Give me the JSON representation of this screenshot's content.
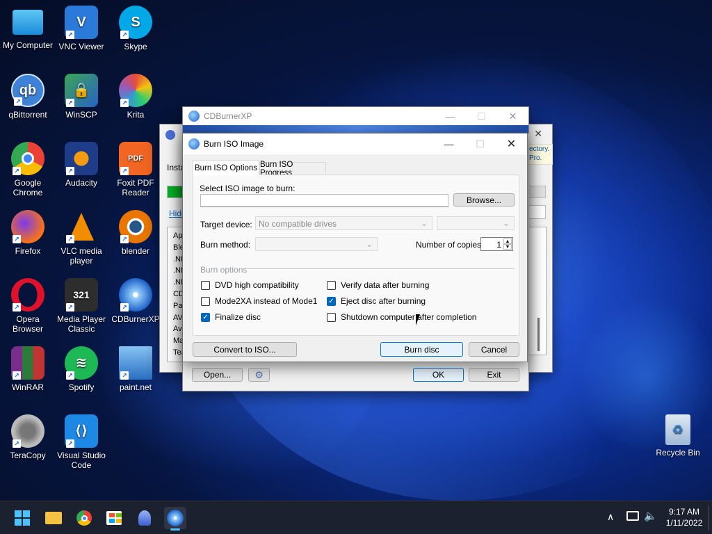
{
  "desktop": {
    "icons": [
      {
        "label": "My Computer",
        "icon": "computer-icon"
      },
      {
        "label": "VNC Viewer",
        "icon": "vnc-icon"
      },
      {
        "label": "Skype",
        "icon": "skype-icon"
      },
      {
        "label": "qBittorrent",
        "icon": "qbittorrent-icon"
      },
      {
        "label": "WinSCP",
        "icon": "winscp-icon"
      },
      {
        "label": "Krita",
        "icon": "krita-icon"
      },
      {
        "label": "Google Chrome",
        "icon": "chrome-icon"
      },
      {
        "label": "Audacity",
        "icon": "audacity-icon"
      },
      {
        "label": "Foxit PDF Reader",
        "icon": "foxit-icon"
      },
      {
        "label": "Firefox",
        "icon": "firefox-icon"
      },
      {
        "label": "VLC media player",
        "icon": "vlc-icon"
      },
      {
        "label": "blender",
        "icon": "blender-icon"
      },
      {
        "label": "Opera Browser",
        "icon": "opera-icon"
      },
      {
        "label": "Media Player Classic",
        "icon": "mpc-icon"
      },
      {
        "label": "CDBurnerXP",
        "icon": "cdburnerxp-icon"
      },
      {
        "label": "WinRAR",
        "icon": "winrar-icon"
      },
      {
        "label": "Spotify",
        "icon": "spotify-icon"
      },
      {
        "label": "paint.net",
        "icon": "paintnet-icon"
      },
      {
        "label": "TeraCopy",
        "icon": "teracopy-icon"
      },
      {
        "label": "Visual Studio Code",
        "icon": "vscode-icon"
      },
      {
        "label": "Recycle Bin",
        "icon": "recycle-bin-icon"
      }
    ]
  },
  "back_window": {
    "partial_texts": [
      "Insta",
      "Hide",
      "App",
      "Blen",
      ".NE",
      ".NE",
      ".NE",
      "CDE",
      "Pai",
      "AVC",
      "Ava",
      "Mal",
      "Tea"
    ],
    "right_texts": [
      "ectory.",
      "Pro."
    ]
  },
  "main_window": {
    "title": "CDBurnerXP",
    "open_label": "Open...",
    "ok_label": "OK",
    "exit_label": "Exit"
  },
  "dialog": {
    "title": "Burn ISO Image",
    "tabs": [
      "Burn ISO Options",
      "Burn ISO Progress"
    ],
    "select_label": "Select ISO image to burn:",
    "iso_path": "",
    "browse_label": "Browse...",
    "target_label": "Target device:",
    "target_value": "No compatible drives",
    "burn_method_label": "Burn method:",
    "copies_label": "Number of copies:",
    "copies_value": "1",
    "options_header": "Burn options",
    "options": [
      {
        "label": "DVD high compatibility",
        "checked": false
      },
      {
        "label": "Verify data after burning",
        "checked": false
      },
      {
        "label": "Mode2XA instead of Mode1",
        "checked": false
      },
      {
        "label": "Eject disc after burning",
        "checked": true
      },
      {
        "label": "Finalize disc",
        "checked": true
      },
      {
        "label": "Shutdown computer after completion",
        "checked": false
      }
    ],
    "convert_label": "Convert to ISO...",
    "burn_label": "Burn disc",
    "cancel_label": "Cancel"
  },
  "taskbar": {
    "time": "9:17 AM",
    "date": "1/11/2022"
  },
  "colors": {
    "accent": "#0067c0",
    "taskbar": "#1c2130"
  }
}
